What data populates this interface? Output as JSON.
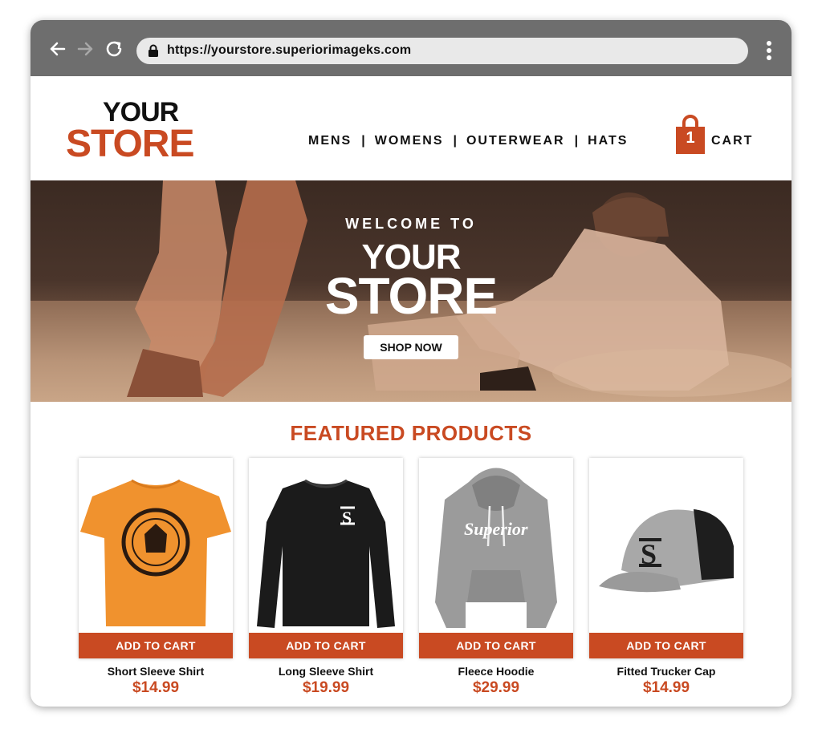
{
  "browser": {
    "url": "https://yourstore.superiorimageks.com",
    "back_icon": "arrow-left-icon",
    "forward_icon": "arrow-right-icon",
    "reload_icon": "reload-icon",
    "lock_icon": "lock-icon",
    "menu_icon": "kebab-menu-icon"
  },
  "header": {
    "logo_line1": "YOUR",
    "logo_line2": "STORE",
    "nav": [
      "MENS",
      "WOMENS",
      "OUTERWEAR",
      "HATS"
    ],
    "nav_separator": "|",
    "cart_count": "1",
    "cart_label": "CART"
  },
  "hero": {
    "welcome": "WELCOME TO",
    "title_line1": "YOUR",
    "title_line2": "STORE",
    "button": "SHOP NOW"
  },
  "featured": {
    "title": "FEATURED PRODUCTS",
    "products": [
      {
        "name": "Short Sleeve Shirt",
        "price": "$14.99",
        "button": "ADD TO CART"
      },
      {
        "name": "Long Sleeve Shirt",
        "price": "$19.99",
        "button": "ADD TO CART"
      },
      {
        "name": "Fleece Hoodie",
        "price": "$29.99",
        "button": "ADD TO CART"
      },
      {
        "name": "Fitted Trucker Cap",
        "price": "$14.99",
        "button": "ADD TO CART"
      }
    ]
  },
  "colors": {
    "accent": "#c94a22",
    "chrome": "#6e6e6e",
    "text": "#111111"
  }
}
